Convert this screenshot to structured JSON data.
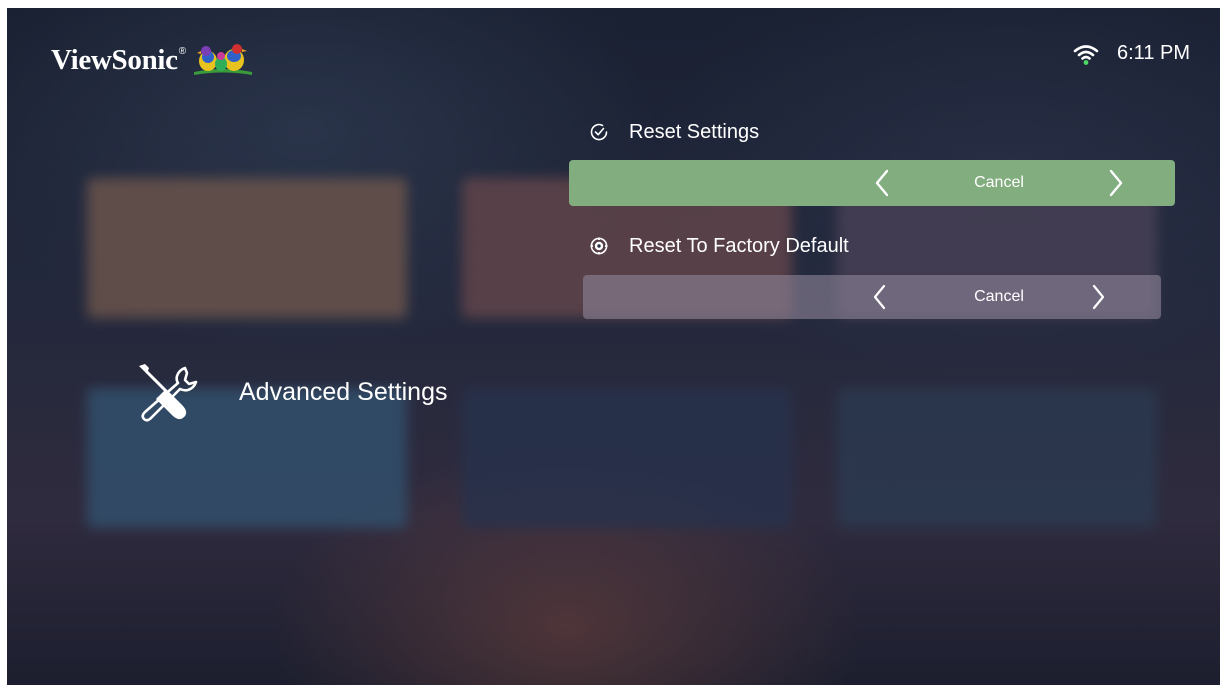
{
  "app": {
    "brand": "ViewSonic",
    "brand_mark": "®"
  },
  "status_bar": {
    "wifi_icon": "wifi-icon",
    "time": "6:11 PM",
    "wifi_color": "#ffffff",
    "wifi_dot_color": "#4cd964"
  },
  "section": {
    "icon": "wrench-screwdriver-icon",
    "label": "Advanced Settings"
  },
  "options": [
    {
      "title": "Reset Settings",
      "icon": "check-circle-icon",
      "value": "Cancel",
      "focused": true
    },
    {
      "title": "Reset To Factory Default",
      "icon": "factory-reset-gear-icon",
      "value": "Cancel",
      "focused": false
    }
  ],
  "colors": {
    "focus_green": "#82ad7f",
    "inactive_bar": "#8c8296"
  }
}
